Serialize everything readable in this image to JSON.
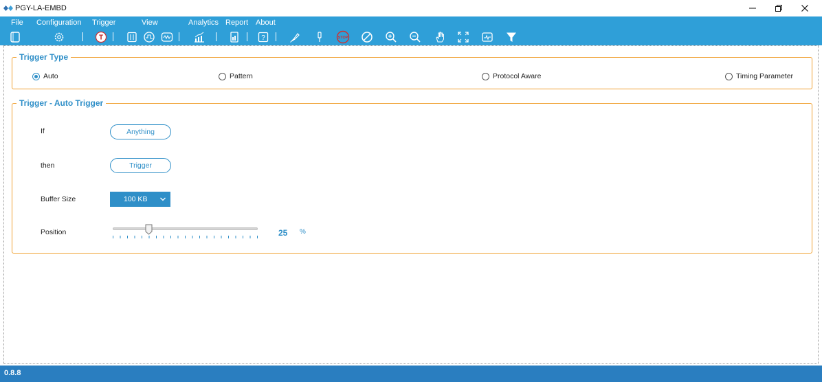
{
  "window": {
    "title": "PGY-LA-EMBD",
    "controls": [
      "minimize-icon",
      "restore-icon",
      "close-icon"
    ]
  },
  "menu": [
    {
      "label": "File"
    },
    {
      "label": "Configuration"
    },
    {
      "label": "Trigger"
    },
    {
      "label": "View"
    },
    {
      "label": "Analytics"
    },
    {
      "label": "Report"
    },
    {
      "label": "About"
    }
  ],
  "toolbar": {
    "icons": [
      "new-file-icon",
      "settings-gear-icon",
      "trigger-t-icon",
      "channel-config-icon",
      "timing-icon",
      "waveform-icon",
      "analytics-chart-icon",
      "report-icon",
      "help-icon",
      "probe-icon",
      "connector-icon",
      "stop-icon",
      "no-signal-icon",
      "zoom-in-icon",
      "zoom-out-icon",
      "pan-hand-icon",
      "fit-screen-icon",
      "measure-icon",
      "filter-icon"
    ]
  },
  "trigger_type": {
    "legend": "Trigger Type",
    "options": [
      "Auto",
      "Pattern",
      "Protocol Aware",
      "Timing Parameter"
    ],
    "selected": "Auto"
  },
  "auto_trigger": {
    "legend": "Trigger - Auto Trigger",
    "if_label": "If",
    "if_value": "Anything",
    "then_label": "then",
    "then_value": "Trigger",
    "buffer_label": "Buffer Size",
    "buffer_value": "100 KB",
    "position_label": "Position",
    "position_value": "25",
    "position_unit": "%",
    "position_fraction": 0.25
  },
  "status": {
    "version": "0.8.8"
  },
  "colors": {
    "accent": "#2f9fd8",
    "group_border": "#f0a030",
    "text_accent": "#2f8fc8",
    "statusbar": "#2a7ec0"
  }
}
